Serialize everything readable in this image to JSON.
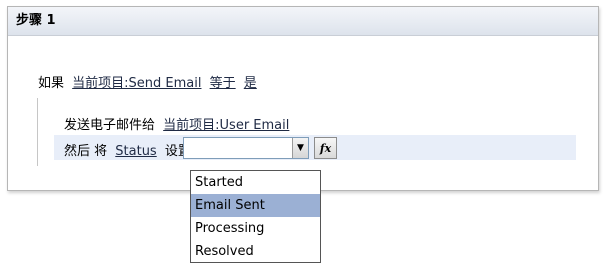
{
  "step": {
    "title": "步骤 1"
  },
  "condition": {
    "if_label": "如果",
    "field": "当前项目:Send Email",
    "operator": "等于",
    "value": "是"
  },
  "action1": {
    "text": "发送电子邮件给",
    "target": "当前项目:User Email"
  },
  "action2": {
    "then_label": "然后 将",
    "field": "Status",
    "set_label": "设置为",
    "combo_value": "",
    "fx_label": "fx"
  },
  "dropdown": {
    "options": [
      "Started",
      "Email Sent",
      "Processing",
      "Resolved"
    ],
    "highlighted": "Email Sent"
  },
  "colors": {
    "highlight_row": "#e8eef9",
    "selected_option": "#9bb0d4"
  }
}
